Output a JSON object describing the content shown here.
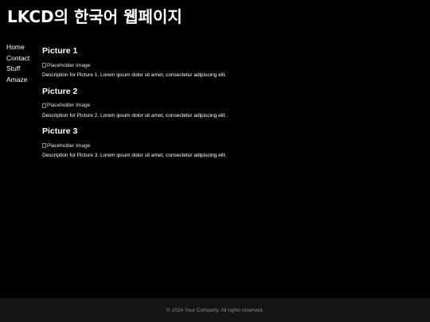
{
  "header": {
    "title": "LKCD의 한국어 웹페이지"
  },
  "nav": {
    "items": [
      {
        "label": "Home"
      },
      {
        "label": "Contact"
      },
      {
        "label": "Stuff"
      },
      {
        "label": "Amaze"
      }
    ]
  },
  "gallery": {
    "items": [
      {
        "title": "Picture 1",
        "alt": "Placeholder Image",
        "description": "Description for Picture 1. Lorem ipsum dolor sit amet, consectetur adipiscing elit."
      },
      {
        "title": "Picture 2",
        "alt": "Placeholder Image",
        "description": "Description for Picture 2. Lorem ipsum dolor sit amet, consectetur adipiscing elit."
      },
      {
        "title": "Picture 3",
        "alt": "Placeholder Image",
        "description": "Description for Picture 3. Lorem ipsum dolor sit amet, consectetur adipiscing elit."
      }
    ]
  },
  "footer": {
    "text": "© 2024 Your Company. All rights reserved."
  }
}
